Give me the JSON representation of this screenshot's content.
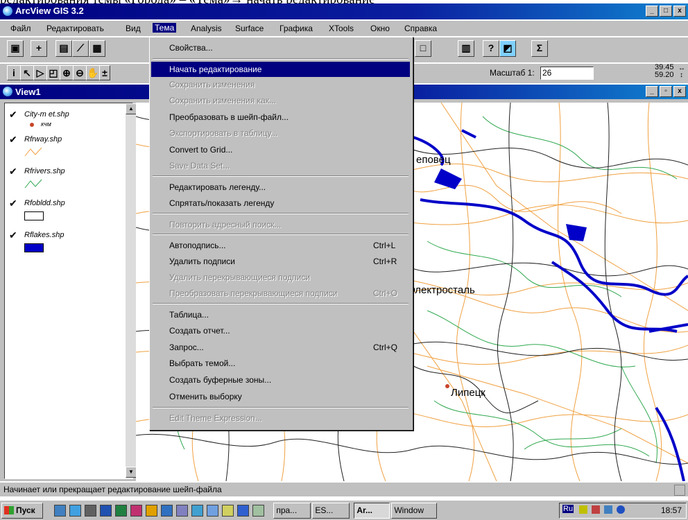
{
  "caption": "редактирования темы «Города» – «Тема»→ начать редактирование",
  "window": {
    "title": "ArcView GIS 3.2",
    "min": "_",
    "max": "□",
    "close": "x"
  },
  "menubar": [
    "Файл",
    "Редактировать",
    "Вид",
    "Тема",
    "Analysis",
    "Surface",
    "Графика",
    "XTools",
    "Окно",
    "Справка"
  ],
  "menubar_active": "Тема",
  "scale": {
    "label": "Масштаб 1:",
    "value": "26"
  },
  "coords": {
    "x": "39.45",
    "y": "59.20"
  },
  "view": {
    "title": "View1"
  },
  "legend": [
    {
      "name": "City-m et.shp",
      "sym_label": "кчм",
      "checked": "✔"
    },
    {
      "name": "Rfrway.shp",
      "checked": "✔"
    },
    {
      "name": "Rfrivers.shp",
      "checked": "✔"
    },
    {
      "name": "Rfobldd.shp",
      "checked": "✔"
    },
    {
      "name": "Rflakes.shp",
      "checked": "✔"
    }
  ],
  "map_labels": {
    "a": "еповец",
    "b": "Электросталь",
    "c": "Липецк"
  },
  "menu": [
    {
      "label": "Свойства...",
      "shortcut": "",
      "state": "normal"
    },
    {
      "label": "Начать редактирование",
      "shortcut": "",
      "state": "highlighted"
    },
    {
      "label": "Сохранить изменения",
      "shortcut": "",
      "state": "disabled"
    },
    {
      "label": "Сохранить изменения как...",
      "shortcut": "",
      "state": "disabled"
    },
    {
      "label": "Преобразовать в шейп-файл...",
      "shortcut": "",
      "state": "normal"
    },
    {
      "label": "Экспортировать в таблицу...",
      "shortcut": "",
      "state": "disabled"
    },
    {
      "label": "Convert to Grid...",
      "shortcut": "",
      "state": "normal"
    },
    {
      "label": "Save Data Set...",
      "shortcut": "",
      "state": "disabled"
    },
    {
      "label": "Редактировать легенду...",
      "shortcut": "",
      "state": "normal"
    },
    {
      "label": "Спрятать/показать легенду",
      "shortcut": "",
      "state": "normal"
    },
    {
      "label": "Повторить адресный поиск...",
      "shortcut": "",
      "state": "disabled"
    },
    {
      "label": "Автоподпись...",
      "shortcut": "Ctrl+L",
      "state": "normal"
    },
    {
      "label": "Удалить подписи",
      "shortcut": "Ctrl+R",
      "state": "normal"
    },
    {
      "label": "Удалить перекрывающиеся подписи",
      "shortcut": "",
      "state": "disabled"
    },
    {
      "label": "Преобразовать перекрывающиеся подписи",
      "shortcut": "Ctrl+O",
      "state": "disabled"
    },
    {
      "label": "Таблица...",
      "shortcut": "",
      "state": "normal"
    },
    {
      "label": "Создать отчет...",
      "shortcut": "",
      "state": "normal"
    },
    {
      "label": "Запрос...",
      "shortcut": "Ctrl+Q",
      "state": "normal"
    },
    {
      "label": "Выбрать темой...",
      "shortcut": "",
      "state": "normal"
    },
    {
      "label": "Создать буферные зоны...",
      "shortcut": "",
      "state": "normal"
    },
    {
      "label": "Отменить выборку",
      "shortcut": "",
      "state": "normal"
    },
    {
      "label": "Edit Theme Expression...",
      "shortcut": "",
      "state": "disabled"
    }
  ],
  "status": "Начинает или прекращает редактирование шейп-файла",
  "taskbar": {
    "start": "Пуск",
    "tasks": [
      "пра...",
      "ES...",
      "Ar...",
      "Window"
    ],
    "lang": "Ru",
    "clock": "18:57"
  },
  "colors": {
    "title_blue": "#000080",
    "face": "#c0c0c0",
    "lakes": "#0000c8",
    "rivers": "#2fa84f",
    "roads": "#f0a040",
    "borders": "#202020"
  }
}
